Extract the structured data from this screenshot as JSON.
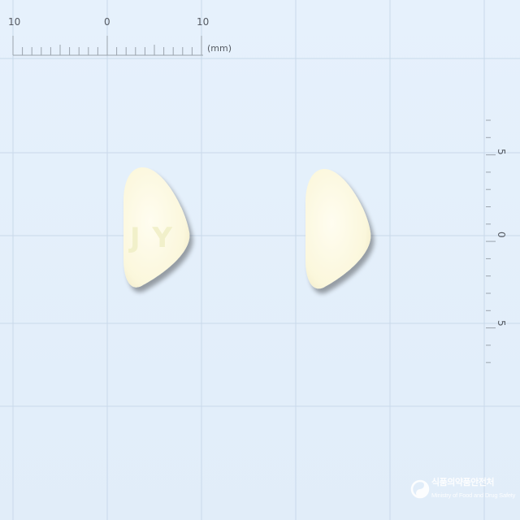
{
  "top_ruler": {
    "labels": [
      "10",
      "0",
      "10"
    ],
    "unit": "(mm)"
  },
  "side_ruler": {
    "labels": [
      "5",
      "0",
      "5"
    ]
  },
  "pills": [
    {
      "side": "front",
      "imprint": "JY",
      "color": "#fbf7dc"
    },
    {
      "side": "back",
      "imprint": "",
      "color": "#fbf7dc"
    }
  ],
  "watermark": {
    "korean": "식품의약품안전처",
    "english": "Ministry of Food and Drug Safety"
  },
  "colors": {
    "background": "#e3effb",
    "grid": "#c9d9ea",
    "ruler": "#9aa3ad",
    "pill": "#fbf7dc"
  }
}
